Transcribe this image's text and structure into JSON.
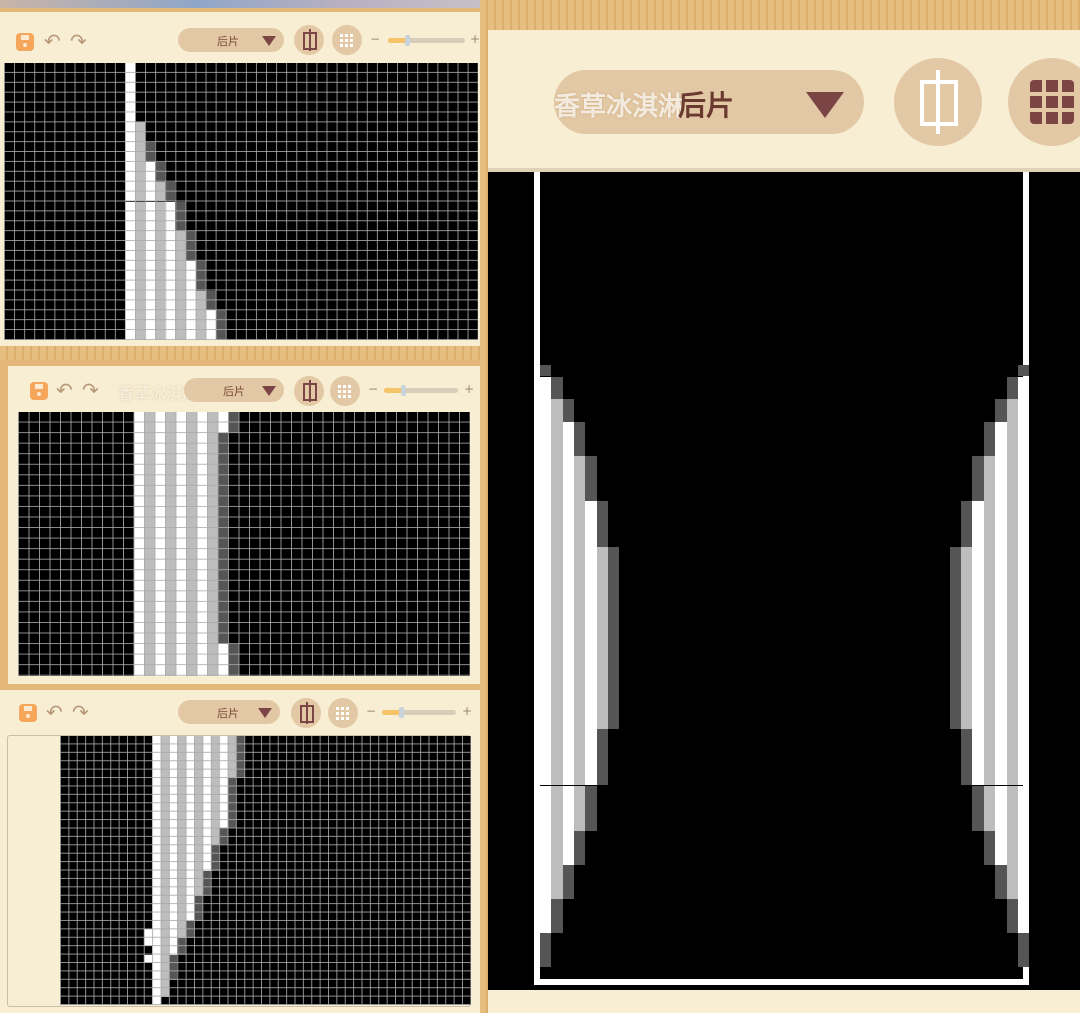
{
  "editor": {
    "piece_select_value": "后片",
    "zoom_minus": "−",
    "zoom_plus": "+",
    "zoom_level_fraction": 0.25,
    "watermark": "香草冰淇淋"
  },
  "colors": {
    "cream": "#f7eed3",
    "accent_brown": "#7b4545",
    "save_orange": "#f5a65b",
    "white_pixel": "#ffffff",
    "light_gray_pixel": "#bdbdbd",
    "dark_gray_pixel": "#555555",
    "black_pixel": "#000000"
  },
  "panels": [
    {
      "name": "panel-1",
      "cols": 47,
      "rows": 28,
      "white_column": 12,
      "stripe_start": 13,
      "extents": [
        12,
        12,
        12,
        12,
        12,
        12,
        13,
        13,
        14,
        14,
        15,
        15,
        16,
        16,
        17,
        17,
        17,
        18,
        18,
        18,
        19,
        19,
        19,
        20,
        20,
        21,
        21,
        21
      ],
      "dark_edge": true,
      "extra_white": []
    },
    {
      "name": "panel-2",
      "cols": 43,
      "rows": 25,
      "white_column": 11,
      "stripe_start": 12,
      "extents": [
        20,
        20,
        19,
        19,
        19,
        19,
        19,
        19,
        19,
        19,
        19,
        19,
        19,
        19,
        19,
        19,
        19,
        19,
        19,
        19,
        19,
        19,
        20,
        20,
        20
      ],
      "dark_edge": true,
      "extra_white": []
    },
    {
      "name": "panel-3",
      "cols": 49,
      "rows": 32,
      "white_column": 11,
      "stripe_start": 12,
      "extents": [
        21,
        21,
        21,
        21,
        21,
        20,
        20,
        20,
        20,
        20,
        20,
        19,
        19,
        18,
        18,
        18,
        17,
        17,
        17,
        16,
        16,
        16,
        15,
        15,
        14,
        14,
        13,
        13,
        13,
        12,
        12,
        11
      ],
      "dark_edge": true,
      "extra_white": [
        [
          23,
          10
        ],
        [
          24,
          10
        ],
        [
          26,
          10
        ]
      ]
    }
  ],
  "large_view": {
    "cols": 52,
    "rows": 72,
    "left_border_col": 4,
    "right_border_col": 47,
    "bottom_border_row": 71,
    "profile": [
      0,
      0,
      0,
      0,
      0,
      0,
      0,
      0,
      0,
      0,
      0,
      0,
      0,
      0,
      0,
      0,
      0,
      1,
      2,
      2,
      3,
      3,
      4,
      4,
      4,
      5,
      5,
      5,
      5,
      6,
      6,
      6,
      6,
      7,
      7,
      7,
      7,
      7,
      7,
      7,
      7,
      7,
      7,
      7,
      7,
      7,
      7,
      7,
      7,
      6,
      6,
      6,
      6,
      6,
      5,
      5,
      5,
      5,
      4,
      4,
      4,
      3,
      3,
      3,
      2,
      2,
      2,
      1,
      1,
      1,
      0,
      0
    ]
  }
}
